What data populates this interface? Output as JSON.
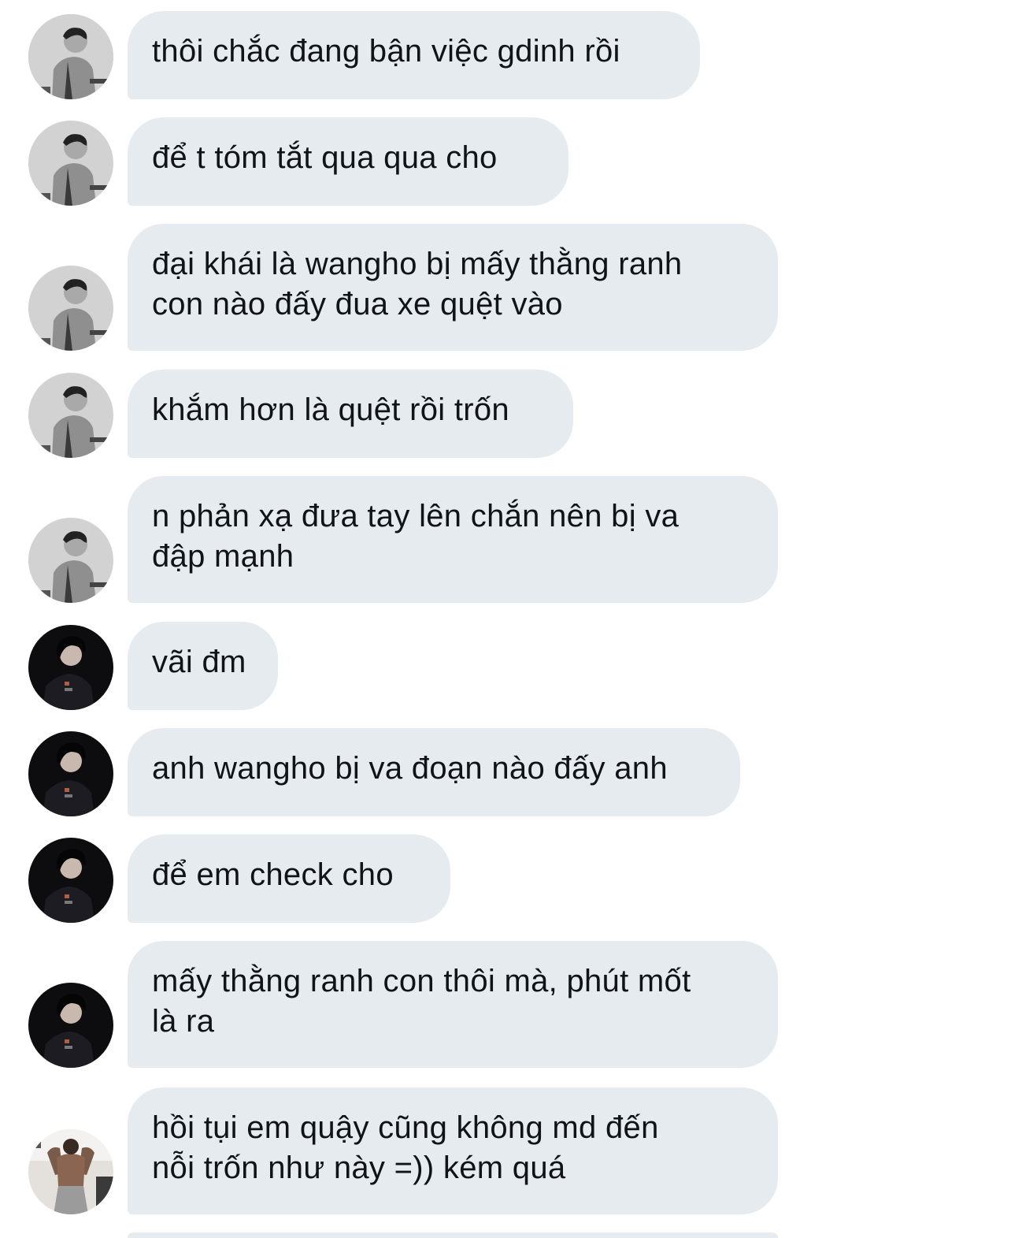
{
  "conversation": {
    "avatar_icons": {
      "sender_a": "grayscale-profile-photo-icon",
      "sender_b": "dark-jersey-profile-photo-icon",
      "sender_c": "gym-mirror-selfie-photo-icon"
    },
    "messages": [
      {
        "sender": "sender_a",
        "text": "thôi chắc đang bận việc gdinh rồi"
      },
      {
        "sender": "sender_a",
        "text": "để t tóm tắt qua qua cho"
      },
      {
        "sender": "sender_a",
        "text": "đại khái là wangho bị mấy thằng ranh\ncon nào đấy đua xe quệt vào"
      },
      {
        "sender": "sender_a",
        "text": "khắm hơn là quệt rồi trốn"
      },
      {
        "sender": "sender_a",
        "text": "n phản xạ đưa tay lên chắn nên bị va\nđập mạnh"
      },
      {
        "sender": "sender_b",
        "text": "vãi đm"
      },
      {
        "sender": "sender_b",
        "text": "anh wangho bị va đoạn nào đấy anh"
      },
      {
        "sender": "sender_b",
        "text": "để em check cho"
      },
      {
        "sender": "sender_b",
        "text": "mấy thằng ranh con thôi mà, phút mốt\nlà ra"
      },
      {
        "sender": "sender_c",
        "text": "hồi tụi em quậy cũng không md đến\nnỗi trốn như này =)) kém quá"
      }
    ],
    "colors": {
      "bubble": "#e6ebf0",
      "text": "#101418",
      "background": "#ffffff"
    }
  }
}
